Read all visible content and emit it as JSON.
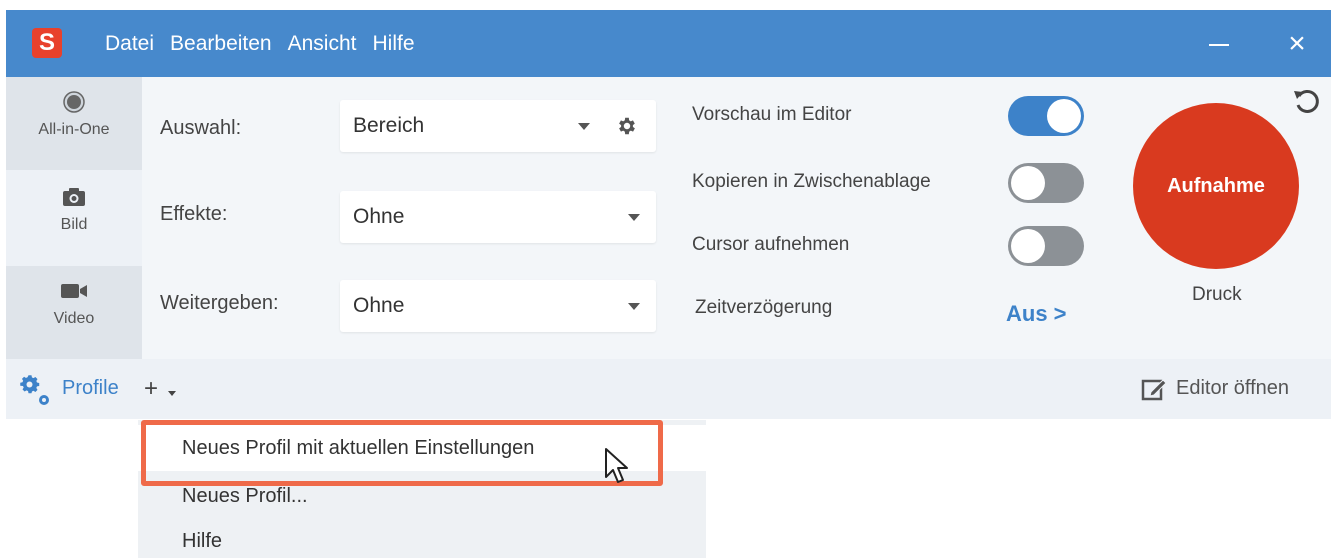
{
  "menu": {
    "items": [
      "Datei",
      "Bearbeiten",
      "Ansicht",
      "Hilfe"
    ],
    "logo_letter": "S"
  },
  "capture_modes": [
    {
      "label": "All-in-One",
      "icon": "radio-icon"
    },
    {
      "label": "Bild",
      "icon": "camera-icon"
    },
    {
      "label": "Video",
      "icon": "video-camera-icon"
    }
  ],
  "settings": {
    "selection": {
      "label": "Auswahl:",
      "value": "Bereich"
    },
    "effects": {
      "label": "Effekte:",
      "value": "Ohne"
    },
    "share": {
      "label": "Weitergeben:",
      "value": "Ohne"
    }
  },
  "options": {
    "preview": {
      "label": "Vorschau im Editor",
      "on": true
    },
    "clipboard": {
      "label": "Kopieren in Zwischenablage",
      "on": false
    },
    "cursor": {
      "label": "Cursor aufnehmen",
      "on": false
    },
    "delay": {
      "label": "Zeitverzögerung",
      "value": "Aus >"
    }
  },
  "record": {
    "label": "Aufnahme",
    "shortcut": "Druck"
  },
  "bottom": {
    "profiles_label": "Profile",
    "add_symbol": "+",
    "editor_label": "Editor öffnen"
  },
  "profile_menu": {
    "items": [
      "Neues Profil mit aktuellen Einstellungen",
      "Neues Profil...",
      "Hilfe"
    ]
  },
  "colors": {
    "titlebar": "#4789cc",
    "accent": "#3d82c9",
    "record": "#d93a1f",
    "highlight": "#ef6a49"
  }
}
